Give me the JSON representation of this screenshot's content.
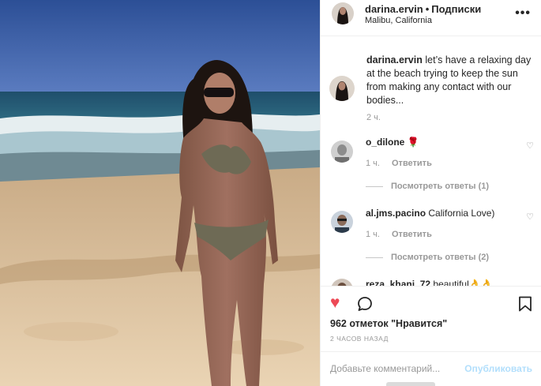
{
  "photo": {
    "description_icon": "beach-photo"
  },
  "header": {
    "username": "darina.ervin",
    "separator": "•",
    "follow_label": "Подписки",
    "location": "Malibu, California",
    "more_icon": "more-options-icon",
    "more_glyph": "•••"
  },
  "caption": {
    "username": "darina.ervin",
    "text": "let’s have a relaxing day at the beach trying to keep the sun from making any contact with our bodies...",
    "time": "2 ч."
  },
  "comments": [
    {
      "username": "o_dilone",
      "text": "",
      "emoji": "🌹",
      "time": "1 ч.",
      "reply_label": "Ответить",
      "view_replies": "Посмотреть ответы (1)"
    },
    {
      "username": "al.jms.pacino",
      "text": "California Love)",
      "time": "1 ч.",
      "reply_label": "Ответить",
      "view_replies": "Посмотреть ответы (2)"
    },
    {
      "username": "reza_khani_72",
      "text": "beautiful👌👌"
    }
  ],
  "actions": {
    "likes": "962 отметок \"Нравится\"",
    "posted_time": "2 ЧАСОВ НАЗАД",
    "like_glyph": "♥",
    "comment_placeholder": "Добавьте комментарий...",
    "publish_label": "Опубликовать"
  },
  "colors": {
    "like": "#ed4956",
    "publish": "#b2dffc",
    "muted": "#999999"
  }
}
